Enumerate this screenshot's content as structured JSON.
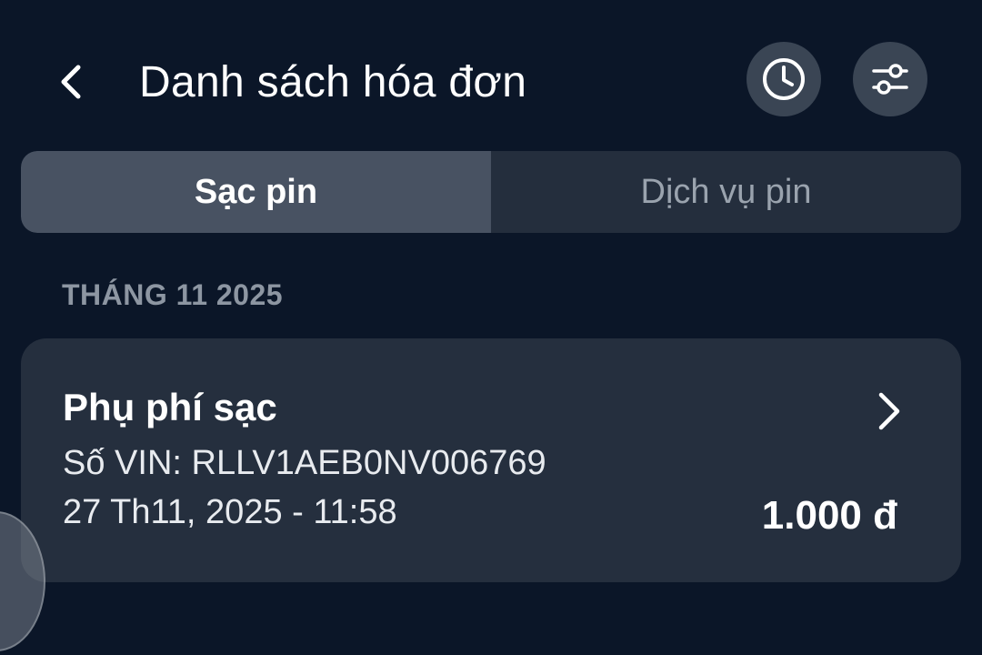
{
  "header": {
    "title": "Danh sách hóa đơn",
    "back_icon": "chevron-left-icon",
    "history_icon": "clock-icon",
    "filter_icon": "sliders-icon"
  },
  "tabs": [
    {
      "label": "Sạc pin",
      "active": true
    },
    {
      "label": "Dịch vụ pin",
      "active": false
    }
  ],
  "section": {
    "label": "THÁNG 11 2025"
  },
  "invoices": [
    {
      "title": "Phụ phí sạc",
      "vin": "Số VIN: RLLV1AEB0NV006769",
      "datetime": "27 Th11, 2025 - 11:58",
      "amount": "1.000 đ"
    }
  ],
  "colors": {
    "background": "#0b1628",
    "card": "#252f3e",
    "tab_active": "#485262",
    "tab_inactive": "#242e3d",
    "icon_button": "#3a4554",
    "muted_text": "#8d96a2"
  }
}
